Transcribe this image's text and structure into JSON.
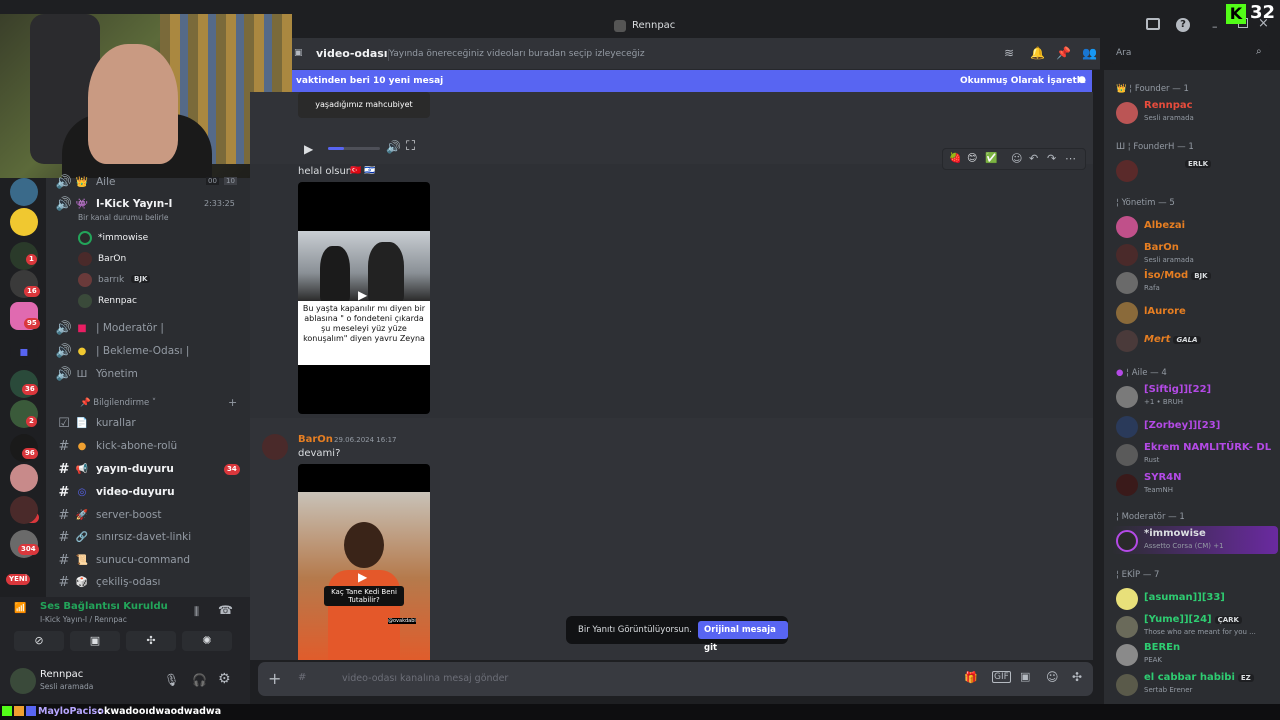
{
  "window": {
    "title": "Rennpac"
  },
  "overlay": {
    "viewer_count": "32",
    "chat_user": "MayloPaciso",
    "chat_message": "kwadooıdwaodwadwa"
  },
  "header": {
    "channel_name": "video-odası",
    "topic": "Yayında önereceğiniz videoları buradan seçip izleyeceğiz",
    "search_placeholder": "Ara"
  },
  "new_messages": {
    "text": "vaktinden beri 10 yeni mesaj",
    "mark_read": "Okunmuş Olarak İşaretle"
  },
  "messages": [
    {
      "text": "helal olsun",
      "video_caption_top": "yaşadığımız mahcubiyet",
      "video_caption": "Bu yaşta kapanılır mı diyen bir ablasına \" o fondeteni çıkarda şu meseleyi yüz yüze konuşalım\" diyen yavru Zeyna"
    },
    {
      "author": "BarOn",
      "timestamp": "29.06.2024 16:17",
      "text": "devami?",
      "video_caption": "Kaç Tane Kedi Beni Tutabilir?",
      "video_handle": "@ovakdabi"
    }
  ],
  "reply_banner": {
    "text": "Bir Yanıtı Görüntülüyorsun.",
    "button": "Orijinal mesaja git"
  },
  "composer": {
    "placeholder": "video-odası kanalına mesaj gönder"
  },
  "channels": {
    "voice_aile": {
      "name": "Aile",
      "count_a": "00",
      "count_b": "10"
    },
    "voice_kick": {
      "name": "I-Kick Yayın-I",
      "status": "Bir kanal durumu belirle",
      "timer": "2:33:25"
    },
    "voice_users": [
      {
        "name": "*immowise"
      },
      {
        "name": "BarOn"
      },
      {
        "name": "barrık",
        "tag": "BJK"
      },
      {
        "name": "Rennpac"
      }
    ],
    "voice_more": [
      "| Moderatör |",
      "| Bekleme-Odası |",
      "Yönetim"
    ],
    "category": "Bilgilendirme",
    "text_channels": [
      {
        "name": "kurallar",
        "unread": false
      },
      {
        "name": "kick-abone-rolü",
        "unread": false
      },
      {
        "name": "yayın-duyuru",
        "unread": true,
        "badge": "34"
      },
      {
        "name": "video-duyuru",
        "unread": true
      },
      {
        "name": "server-boost",
        "unread": false
      },
      {
        "name": "sınırsız-davet-linki",
        "unread": false
      },
      {
        "name": "sunucu-command",
        "unread": false
      },
      {
        "name": "çekiliş-odası",
        "unread": false
      }
    ]
  },
  "server_badges": [
    "1",
    "16",
    "95",
    "36",
    "2",
    "96",
    "149",
    "304"
  ],
  "server_new": "YENİ",
  "voice_status": {
    "title": "Ses Bağlantısı Kuruldu",
    "channel": "I-Kick Yayın-I / Rennpac"
  },
  "user": {
    "name": "Rennpac",
    "status": "Sesli aramada"
  },
  "members": {
    "sections": [
      {
        "title": "Founder — 1"
      },
      {
        "title": "FounderH — 1"
      },
      {
        "title": "Yönetim — 5"
      },
      {
        "title": "Aile — 4"
      },
      {
        "title": "Moderatör — 1"
      },
      {
        "title": "EKİP — 7"
      }
    ],
    "list": [
      {
        "name": "Rennpac",
        "status": "Sesli aramada",
        "color": "#e74c3c"
      },
      {
        "name": "",
        "tag": "ERLK",
        "color": "#e74c3c"
      },
      {
        "name": "Albezai",
        "status": "",
        "color": "#e67e22"
      },
      {
        "name": "BarOn",
        "status": "Sesli aramada",
        "color": "#e67e22"
      },
      {
        "name": "İso/Mod",
        "tag": "BJK",
        "status": "Rafa",
        "color": "#e67e22"
      },
      {
        "name": "lAurore",
        "status": "",
        "color": "#e67e22"
      },
      {
        "name": "Mert",
        "tag": "GALA",
        "status": "",
        "color": "#e67e22"
      },
      {
        "name": "[Siftig]][22]",
        "status": "+1 • BRUH",
        "color": "#b44ae6"
      },
      {
        "name": "[Zorbey]][23]",
        "status": "",
        "color": "#b44ae6"
      },
      {
        "name": "Ekrem NAMLITÜRK- DL",
        "status": "Rust",
        "color": "#b44ae6"
      },
      {
        "name": "SYR4N",
        "status": "TeamNH",
        "color": "#b44ae6"
      },
      {
        "name": "*immowise",
        "status": "Assetto Corsa (CM) +1",
        "color": "#dbdee1"
      },
      {
        "name": "[asuman]][33]",
        "status": "",
        "color": "#2ecc71"
      },
      {
        "name": "[Yume]][24]",
        "tag": "ÇARK",
        "status": "Those who are meant for you ...",
        "color": "#2ecc71"
      },
      {
        "name": "BEREn",
        "status": "PEAK",
        "color": "#2ecc71"
      },
      {
        "name": "el cabbar habibi",
        "tag": "EZ",
        "status": "Sertab Erener",
        "color": "#2ecc71"
      }
    ]
  }
}
